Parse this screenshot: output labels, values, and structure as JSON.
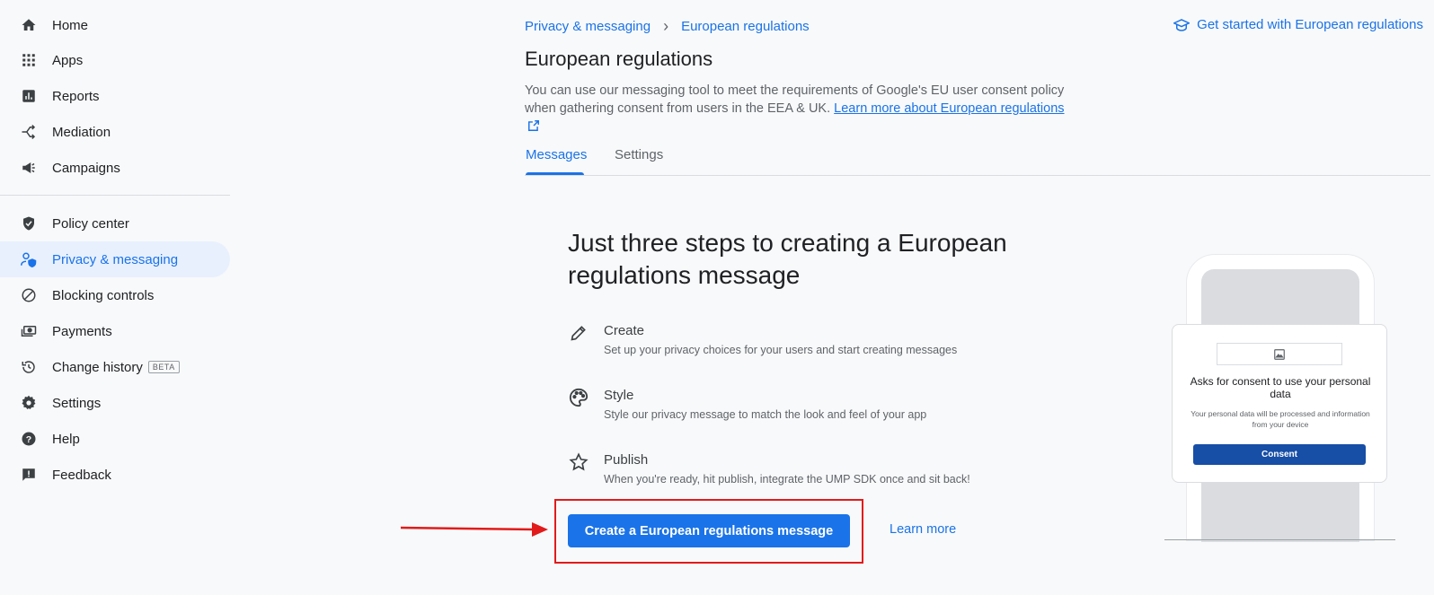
{
  "sidebar": {
    "items": [
      {
        "label": "Home",
        "icon": "home-icon"
      },
      {
        "label": "Apps",
        "icon": "apps-grid-icon"
      },
      {
        "label": "Reports",
        "icon": "reports-icon"
      },
      {
        "label": "Mediation",
        "icon": "mediation-icon"
      },
      {
        "label": "Campaigns",
        "icon": "megaphone-icon"
      },
      {
        "label": "Policy center",
        "icon": "shield-check-icon"
      },
      {
        "label": "Privacy & messaging",
        "icon": "privacy-user-icon"
      },
      {
        "label": "Blocking controls",
        "icon": "block-icon"
      },
      {
        "label": "Payments",
        "icon": "payments-icon"
      },
      {
        "label": "Change history",
        "icon": "history-icon",
        "badge": "BETA"
      },
      {
        "label": "Settings",
        "icon": "gear-icon"
      },
      {
        "label": "Help",
        "icon": "help-icon"
      },
      {
        "label": "Feedback",
        "icon": "feedback-icon"
      }
    ],
    "active": "Privacy & messaging"
  },
  "header": {
    "breadcrumb": [
      "Privacy & messaging",
      "European regulations"
    ],
    "top_link": "Get started with European regulations",
    "title": "European regulations",
    "description": "You can use our messaging tool to meet the requirements of Google's EU user consent policy when gathering consent from users in the EEA & UK.",
    "description_link": "Learn more about European regulations"
  },
  "tabs": [
    {
      "label": "Messages",
      "active": true
    },
    {
      "label": "Settings",
      "active": false
    }
  ],
  "main": {
    "headline": "Just three steps to creating a European regulations message",
    "steps": [
      {
        "title": "Create",
        "desc": "Set up your privacy choices for your users and start creating messages",
        "icon": "pencil-icon"
      },
      {
        "title": "Style",
        "desc": "Style our privacy message to match the look and feel of your app",
        "icon": "palette-icon"
      },
      {
        "title": "Publish",
        "desc": "When you're ready, hit publish, integrate the UMP SDK once and sit back!",
        "icon": "star-icon"
      }
    ],
    "cta_label": "Create a European regulations message",
    "learn_more": "Learn more"
  },
  "illustration": {
    "card_title": "Asks for consent to use your personal data",
    "card_desc": "Your personal data will be processed and information from your device",
    "card_button": "Consent"
  },
  "colors": {
    "accent": "#1a73e8",
    "active_bg": "#e8f0fe",
    "highlight": "#e11b1b"
  }
}
